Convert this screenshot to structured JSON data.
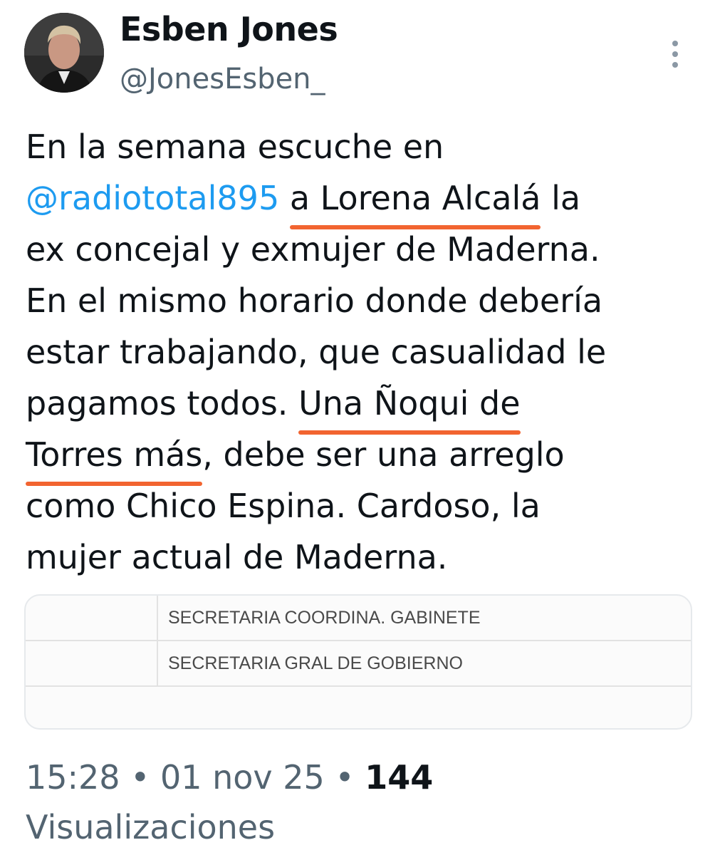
{
  "author": {
    "name": "Esben Jones",
    "handle": "@JonesEsben_"
  },
  "icons": {
    "more": "more-vertical-icon",
    "avatar": "profile-photo"
  },
  "tweet": {
    "line1": "En la semana escuche en",
    "line2_mention": "@radiototal895",
    "line2_highlight": "a Lorena Alcalá",
    "line2_rest": "la",
    "line3": "ex concejal y exmujer de Maderna.",
    "line4": "En el mismo horario donde debería",
    "line5": "estar trabajando, que casualidad le",
    "line6_pre": "pagamos todos.",
    "line6_highlight": "Una Ñoqui de",
    "line7_highlight": "Torres más",
    "line7_rest": ", debe ser una arreglo",
    "line8": "como Chico Espina. Cardoso, la",
    "line9": "mujer actual de Maderna."
  },
  "media": {
    "rows": [
      {
        "col_a": "",
        "col_b": "SECRETARIA COORDINA. GABINETE"
      },
      {
        "col_a": "",
        "col_b": "SECRETARIA GRAL DE GOBIERNO"
      }
    ]
  },
  "meta": {
    "time": "15:28",
    "separator": "•",
    "date": "01 nov 25",
    "views_count": "144",
    "views_label": "Visualizaciones"
  },
  "colors": {
    "mention": "#1d9bf0",
    "highlight_underline": "#f26430",
    "secondary_text": "#536471",
    "primary_text": "#0f1419"
  }
}
